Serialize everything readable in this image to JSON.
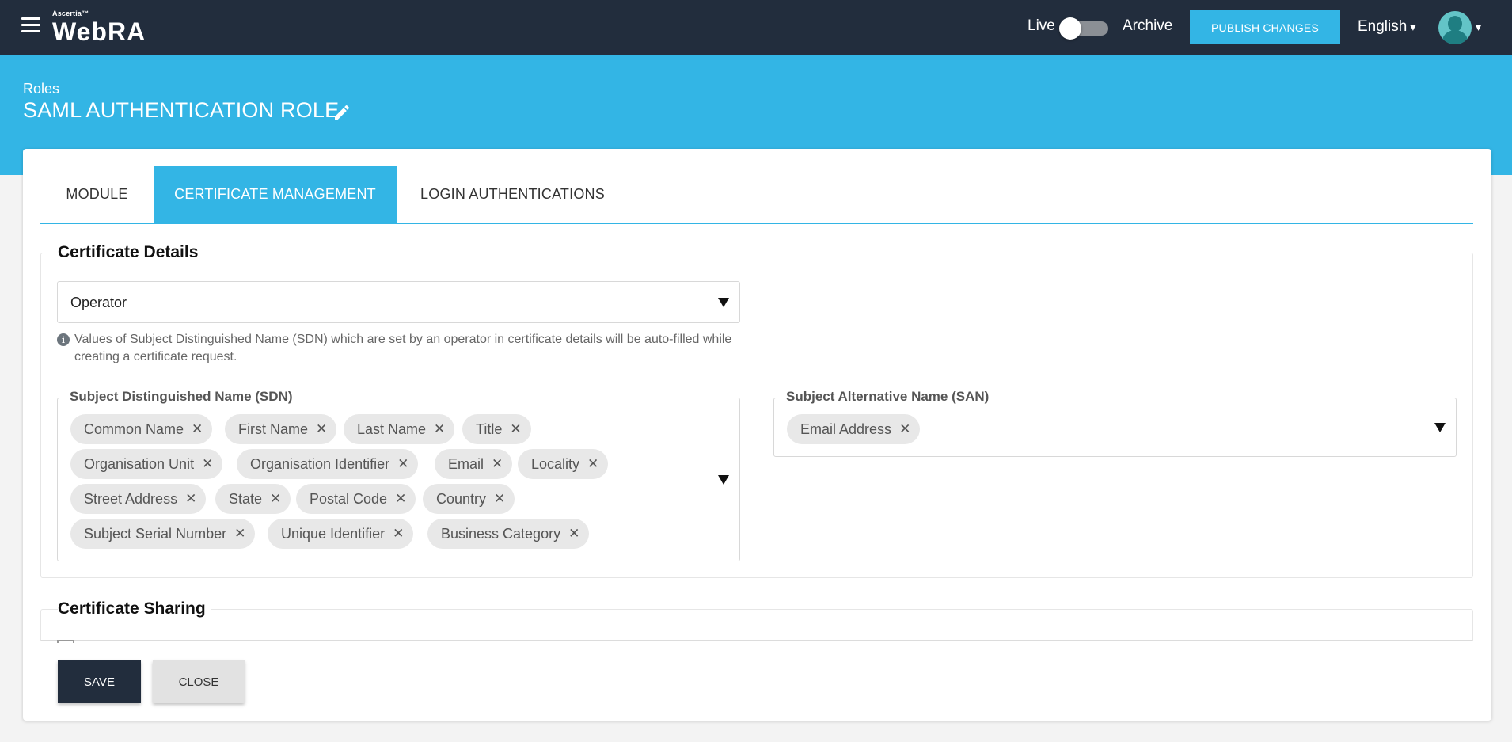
{
  "header": {
    "logo_small": "Ascertia™",
    "logo_main": "WebRA",
    "live_label": "Live",
    "archive_label": "Archive",
    "publish_label": "PUBLISH CHANGES",
    "language": "English",
    "caret": "▾",
    "colors": {
      "bar": "#222d3d",
      "accent": "#33b5e5"
    }
  },
  "page": {
    "breadcrumb": "Roles",
    "title": "SAML AUTHENTICATION ROLE"
  },
  "tabs": [
    {
      "label": "MODULE",
      "active": false
    },
    {
      "label": "CERTIFICATE MANAGEMENT",
      "active": true
    },
    {
      "label": "LOGIN AUTHENTICATIONS",
      "active": false
    }
  ],
  "certificate_details": {
    "title": "Certificate Details",
    "select_value": "Operator",
    "info_text": "Values of Subject Distinguished Name (SDN) which are set by an operator in certificate details will be auto-filled while creating a certificate request.",
    "sdn": {
      "label": "Subject Distinguished Name (SDN)",
      "chips": [
        "Common Name",
        "First Name",
        "Last Name",
        "Title",
        "Organisation Unit",
        "Organisation Identifier",
        "Email",
        "Locality",
        "Street Address",
        "State",
        "Postal Code",
        "Country",
        "Subject Serial Number",
        "Unique Identifier",
        "Business Category"
      ]
    },
    "san": {
      "label": "Subject Alternative Name (SAN)",
      "chips": [
        "Email Address"
      ]
    }
  },
  "certificate_sharing": {
    "title": "Certificate Sharing"
  },
  "footer": {
    "save_label": "SAVE",
    "close_label": "CLOSE"
  }
}
